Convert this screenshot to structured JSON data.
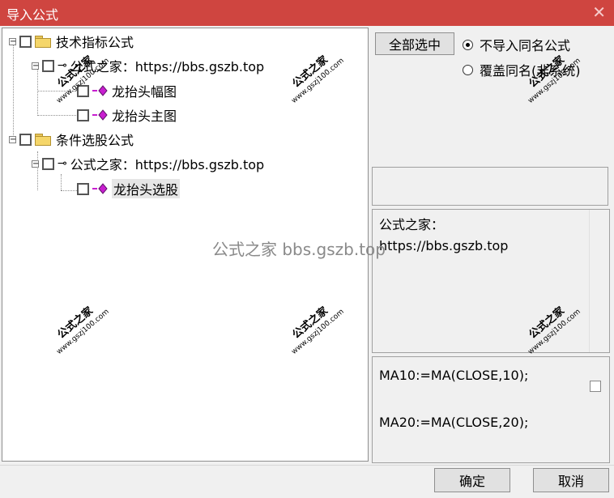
{
  "window": {
    "title": "导入公式",
    "close_glyph": "✕"
  },
  "tree": {
    "nodes": [
      {
        "label": "技术指标公式",
        "type": "folder",
        "expander": "−"
      },
      {
        "label": "公式之家：https://bbs.gszb.top",
        "type": "key",
        "expander": "−"
      },
      {
        "label": "龙抬头幅图",
        "type": "formula"
      },
      {
        "label": "龙抬头主图",
        "type": "formula"
      },
      {
        "label": "条件选股公式",
        "type": "folder",
        "expander": "−"
      },
      {
        "label": "公式之家：https://bbs.gszb.top",
        "type": "key",
        "expander": "−"
      },
      {
        "label": "龙抬头选股",
        "type": "formula",
        "selected": true
      }
    ]
  },
  "options": {
    "select_all_label": "全部选中",
    "radio_no_import_same": "不导入同名公式",
    "radio_overwrite_same": "覆盖同名(非系统)",
    "selected_radio": "no_import_same"
  },
  "info": {
    "line1": "公式之家：",
    "line2": "https://bbs.gszb.top"
  },
  "code": {
    "line1": "MA10:=MA(CLOSE,10);",
    "line2": "MA20:=MA(CLOSE,20);"
  },
  "buttons": {
    "ok_label": "确定",
    "cancel_label": "取消"
  },
  "watermark": {
    "main_text": "公式之家",
    "url_text": "www.gszj100.com",
    "center_text": "公式之家 bbs.gszb.top"
  },
  "colors": {
    "titlebar": "#cf4540",
    "formula_icon": "#c81fd0",
    "folder": "#f5d66a"
  }
}
